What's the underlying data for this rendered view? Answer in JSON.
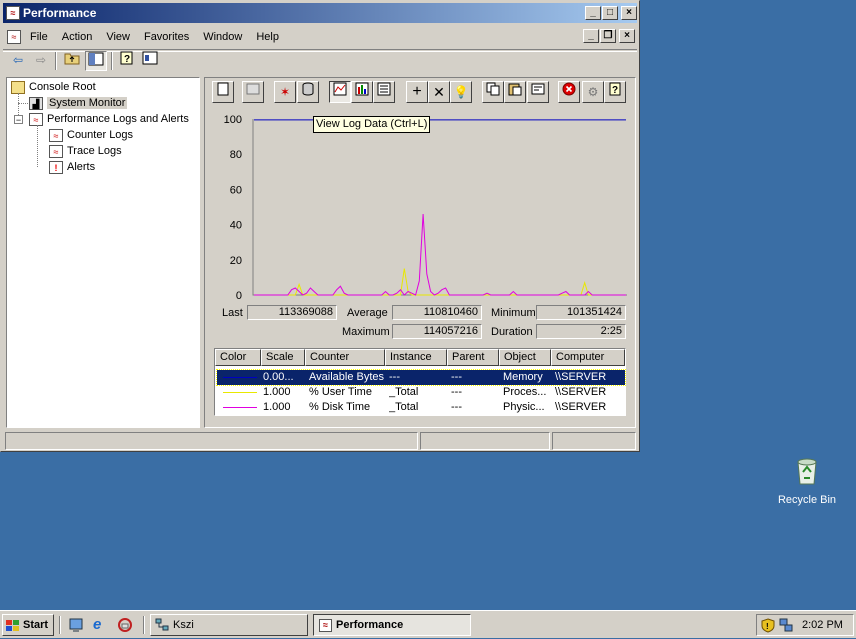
{
  "window": {
    "title": "Performance"
  },
  "menu": [
    "File",
    "Action",
    "View",
    "Favorites",
    "Window",
    "Help"
  ],
  "tree": {
    "root": "Console Root",
    "items": [
      {
        "label": "System Monitor",
        "selected": true
      },
      {
        "label": "Performance Logs and Alerts"
      },
      {
        "label": "Counter Logs"
      },
      {
        "label": "Trace Logs"
      },
      {
        "label": "Alerts"
      }
    ]
  },
  "tooltip": "View Log Data (Ctrl+L)",
  "chart_data": {
    "type": "line",
    "ylim": [
      0,
      100
    ],
    "yticks": [
      "100",
      "80",
      "60",
      "40",
      "20",
      "0"
    ],
    "series": [
      {
        "name": "Available Bytes",
        "color": "#0000c0",
        "values": [
          99.5,
          99.5,
          99.5,
          99.5,
          99.5,
          99.5,
          99.5,
          99.5,
          99.5,
          99.5,
          99.5,
          99.5,
          99.5,
          99.5,
          99.5,
          99.5,
          99.5,
          99.5,
          99.5,
          99.5,
          99.5,
          99.5,
          99.5,
          99.5,
          99.5,
          99.5,
          99.5,
          99.5,
          99.5,
          99.5,
          99.5,
          99.5,
          99.5,
          99.5,
          99.5,
          99.5,
          99.5,
          99.5,
          99.5,
          99.5,
          99.5,
          99.5,
          99.5,
          99.5,
          99.5,
          99.5,
          99.5,
          99.5,
          99.5,
          99.5,
          99.5,
          99.5,
          99.5,
          99.5,
          99.5,
          99.5,
          99.5,
          99.5,
          99.5,
          99.5,
          99.5,
          99.5,
          99.5,
          99.5,
          99.5,
          99.5,
          99.5,
          99.5,
          99.5,
          99.5,
          99.5,
          99.5,
          99.5,
          99.5,
          99.5,
          99.5,
          99.5,
          99.5,
          99.5,
          99.5,
          99.5,
          99.5,
          99.5,
          99.5,
          99.5,
          99.5,
          99.5,
          99.5,
          99.5,
          99.5,
          99.5,
          99.5,
          99.5,
          99.5,
          99.5,
          99.5,
          99.5,
          99.5,
          99.5,
          99.5
        ]
      },
      {
        "name": "% User Time",
        "color": "#e8e800",
        "values": [
          0,
          0,
          0,
          0,
          0,
          0,
          0,
          0,
          0,
          0,
          0,
          0,
          6,
          0,
          0,
          0,
          0,
          0,
          0,
          0,
          0,
          0,
          0,
          0,
          0,
          0,
          0,
          0,
          0,
          0,
          0,
          0,
          0,
          0,
          0,
          0,
          0,
          0,
          0,
          0,
          15,
          2,
          0,
          0,
          0,
          0,
          0,
          0,
          0,
          0,
          0,
          0,
          0,
          0,
          0,
          0,
          0,
          0,
          0,
          0,
          0,
          0,
          0,
          0,
          0,
          0,
          0,
          0,
          0,
          0,
          0,
          0,
          0,
          0,
          0,
          0,
          0,
          0,
          0,
          0,
          0,
          0,
          0,
          0,
          0,
          0,
          0,
          0,
          7,
          0,
          0,
          0,
          0,
          0,
          0,
          0,
          0,
          0,
          0,
          0
        ]
      },
      {
        "name": "% Disk Time",
        "color": "#e000e0",
        "values": [
          0,
          0,
          0,
          0,
          0,
          0,
          0,
          0,
          0,
          0,
          3,
          4,
          2,
          0,
          1,
          4,
          2,
          0,
          0,
          0,
          0,
          0,
          3,
          5,
          1,
          0,
          0,
          0,
          0,
          0,
          0,
          0,
          0,
          0,
          0,
          2,
          0,
          0,
          1,
          3,
          0,
          2,
          1,
          0,
          8,
          46,
          12,
          2,
          0,
          1,
          3,
          4,
          0,
          0,
          0,
          0,
          0,
          0,
          0,
          0,
          0,
          0,
          1,
          0,
          0,
          0,
          0,
          0,
          0,
          2,
          0,
          0,
          0,
          0,
          0,
          0,
          0,
          0,
          0,
          0,
          0,
          0,
          1,
          2,
          0,
          0,
          0,
          0,
          0,
          2,
          0,
          0,
          0,
          0,
          0,
          0,
          0,
          0,
          0,
          0
        ]
      }
    ]
  },
  "stats": {
    "last_label": "Last",
    "last": "113369088",
    "average_label": "Average",
    "average": "110810460",
    "minimum_label": "Minimum",
    "minimum": "101351424",
    "maximum_label": "Maximum",
    "maximum": "114057216",
    "duration_label": "Duration",
    "duration": "2:25"
  },
  "legend": {
    "headers": [
      "Color",
      "Scale",
      "Counter",
      "Instance",
      "Parent",
      "Object",
      "Computer"
    ],
    "rows": [
      {
        "color": "#0000c0",
        "scale": "0.00...",
        "counter": "Available Bytes",
        "instance": "---",
        "parent": "---",
        "object": "Memory",
        "computer": "\\\\SERVER"
      },
      {
        "color": "#e8e800",
        "scale": "1.000",
        "counter": "% User Time",
        "instance": "_Total",
        "parent": "---",
        "object": "Proces...",
        "computer": "\\\\SERVER"
      },
      {
        "color": "#e000e0",
        "scale": "1.000",
        "counter": "% Disk Time",
        "instance": "_Total",
        "parent": "---",
        "object": "Physic...",
        "computer": "\\\\SERVER"
      }
    ]
  },
  "desktop": {
    "recycle_bin": "Recycle Bin"
  },
  "taskbar": {
    "start": "Start",
    "task1": "Kszi",
    "task2": "Performance",
    "clock": "2:02 PM"
  }
}
